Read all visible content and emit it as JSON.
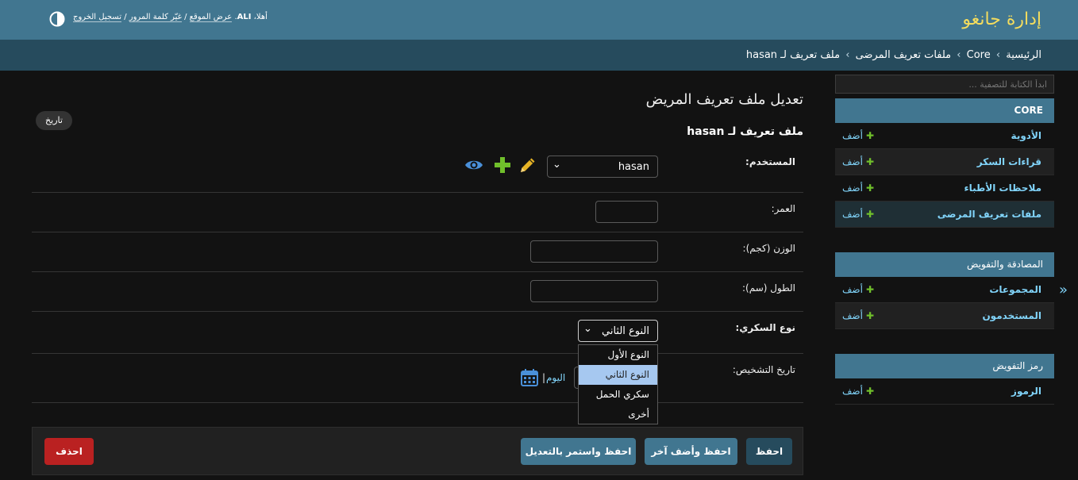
{
  "header": {
    "branding": "إدارة جانغو",
    "welcome": "أهلا،",
    "username": "ALI",
    "view_site": "عرض الموقع",
    "change_password": "غيّر كلمة المرور",
    "logout": "تسجيل الخروج",
    "separator": "/"
  },
  "breadcrumbs": {
    "home": "الرئيسية",
    "app": "Core",
    "model": "ملفات تعريف المرضى",
    "current": "ملف تعريف لـ hasan",
    "separator": "›"
  },
  "sidebar": {
    "filter_placeholder": "ابدأ الكتابة للتصفية ...",
    "add_label": "أضف",
    "modules": [
      {
        "caption": "CORE",
        "models": [
          {
            "name": "الأدوية"
          },
          {
            "name": "قراءات السكر"
          },
          {
            "name": "ملاحظات الأطباء"
          },
          {
            "name": "ملفات تعريف المرضى",
            "current": true
          }
        ]
      },
      {
        "caption": "المصادقة والتفويض",
        "models": [
          {
            "name": "المجموعات"
          },
          {
            "name": "المستخدمون"
          }
        ]
      },
      {
        "caption": "رمز التفويض",
        "models": [
          {
            "name": "الرموز"
          }
        ]
      }
    ],
    "collapse_icon": "«"
  },
  "content": {
    "title": "تعديل ملف تعريف المريض",
    "history_button": "تاريخ",
    "fieldset_title": "ملف تعريف لـ hasan"
  },
  "form": {
    "user": {
      "label": "المستخدم:",
      "value": "hasan"
    },
    "age": {
      "label": "العمر:",
      "value": ""
    },
    "weight": {
      "label": "الوزن (كجم):",
      "value": ""
    },
    "height": {
      "label": "الطول (سم):",
      "value": ""
    },
    "diabetes_type": {
      "label": "نوع السكري:",
      "selected": "النوع الثاني",
      "options": [
        "النوع الأول",
        "النوع الثاني",
        "سكري الحمل",
        "أخرى"
      ]
    },
    "diagnosis_date": {
      "label": "تاريخ التشخيص:",
      "today": "اليوم",
      "separator": "|"
    }
  },
  "submit": {
    "save": "احفظ",
    "save_add_another": "احفظ وأضف آخر",
    "save_continue": "احفظ واستمر بالتعديل",
    "delete": "احذف"
  },
  "colors": {
    "header_bg": "#417690",
    "breadcrumbs_bg": "#264b5d",
    "branding": "#f5dd5d",
    "link": "#81d4fa",
    "add_plus": "#70bf2b",
    "edit_icon": "#e6b325",
    "view_icon": "#4a90d9",
    "danger": "#ba2121"
  },
  "icons": {
    "theme": "theme-toggle-icon",
    "edit": "pencil-icon",
    "add": "plus-icon",
    "view": "eye-icon",
    "calendar": "calendar-icon"
  }
}
